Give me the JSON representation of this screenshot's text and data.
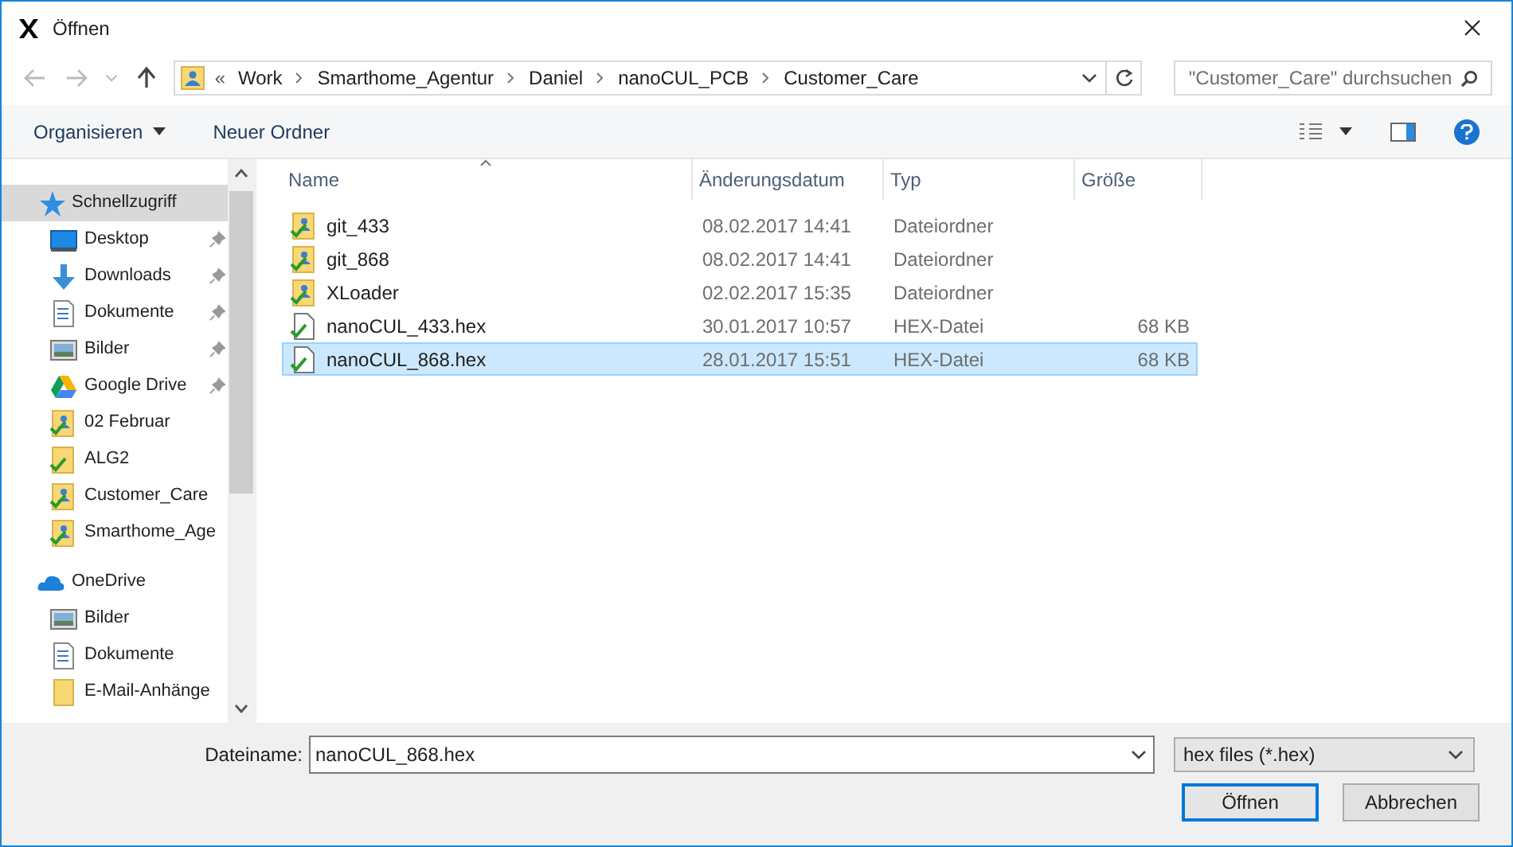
{
  "window": {
    "title": "Öffnen"
  },
  "address": {
    "chevron": "«",
    "crumbs": [
      "Work",
      "Smarthome_Agentur",
      "Daniel",
      "nanoCUL_PCB",
      "Customer_Care"
    ]
  },
  "search": {
    "placeholder": "\"Customer_Care\" durchsuchen"
  },
  "toolbar": {
    "organize": "Organisieren",
    "new_folder": "Neuer Ordner"
  },
  "sidebar": {
    "items": [
      {
        "label": "Schnellzugriff",
        "kind": "quick-access",
        "selected": true,
        "pinned": false
      },
      {
        "label": "Desktop",
        "kind": "desktop",
        "selected": false,
        "pinned": true
      },
      {
        "label": "Downloads",
        "kind": "downloads",
        "selected": false,
        "pinned": true
      },
      {
        "label": "Dokumente",
        "kind": "documents",
        "selected": false,
        "pinned": true
      },
      {
        "label": "Bilder",
        "kind": "pictures",
        "selected": false,
        "pinned": true
      },
      {
        "label": "Google Drive",
        "kind": "drive",
        "selected": false,
        "pinned": true
      },
      {
        "label": "02 Februar",
        "kind": "synced-folder",
        "selected": false,
        "pinned": false
      },
      {
        "label": "ALG2",
        "kind": "synced-plain",
        "selected": false,
        "pinned": false
      },
      {
        "label": "Customer_Care",
        "kind": "synced-folder",
        "selected": false,
        "pinned": false
      },
      {
        "label": "Smarthome_Age",
        "kind": "synced-folder",
        "selected": false,
        "pinned": false
      },
      {
        "label": "OneDrive",
        "kind": "cloud",
        "selected": false,
        "pinned": false
      },
      {
        "label": "Bilder",
        "kind": "pictures",
        "selected": false,
        "pinned": false
      },
      {
        "label": "Dokumente",
        "kind": "documents",
        "selected": false,
        "pinned": false
      },
      {
        "label": "E-Mail-Anhänge",
        "kind": "folder",
        "selected": false,
        "pinned": false
      }
    ]
  },
  "table": {
    "columns": [
      "Name",
      "Änderungsdatum",
      "Typ",
      "Größe"
    ],
    "rows": [
      {
        "name": "git_433",
        "date": "08.02.2017 14:41",
        "type": "Dateiordner",
        "size": "",
        "kind": "synced-folder",
        "selected": false
      },
      {
        "name": "git_868",
        "date": "08.02.2017 14:41",
        "type": "Dateiordner",
        "size": "",
        "kind": "synced-folder",
        "selected": false
      },
      {
        "name": "XLoader",
        "date": "02.02.2017 15:35",
        "type": "Dateiordner",
        "size": "",
        "kind": "synced-folder",
        "selected": false
      },
      {
        "name": "nanoCUL_433.hex",
        "date": "30.01.2017 10:57",
        "type": "HEX-Datei",
        "size": "68 KB",
        "kind": "file",
        "selected": false
      },
      {
        "name": "nanoCUL_868.hex",
        "date": "28.01.2017 15:51",
        "type": "HEX-Datei",
        "size": "68 KB",
        "kind": "file",
        "selected": true
      }
    ]
  },
  "footer": {
    "filename_label": "Dateiname:",
    "filename": "nanoCUL_868.hex",
    "filter": "hex files (*.hex)",
    "open": "Öffnen",
    "cancel": "Abbrechen"
  }
}
